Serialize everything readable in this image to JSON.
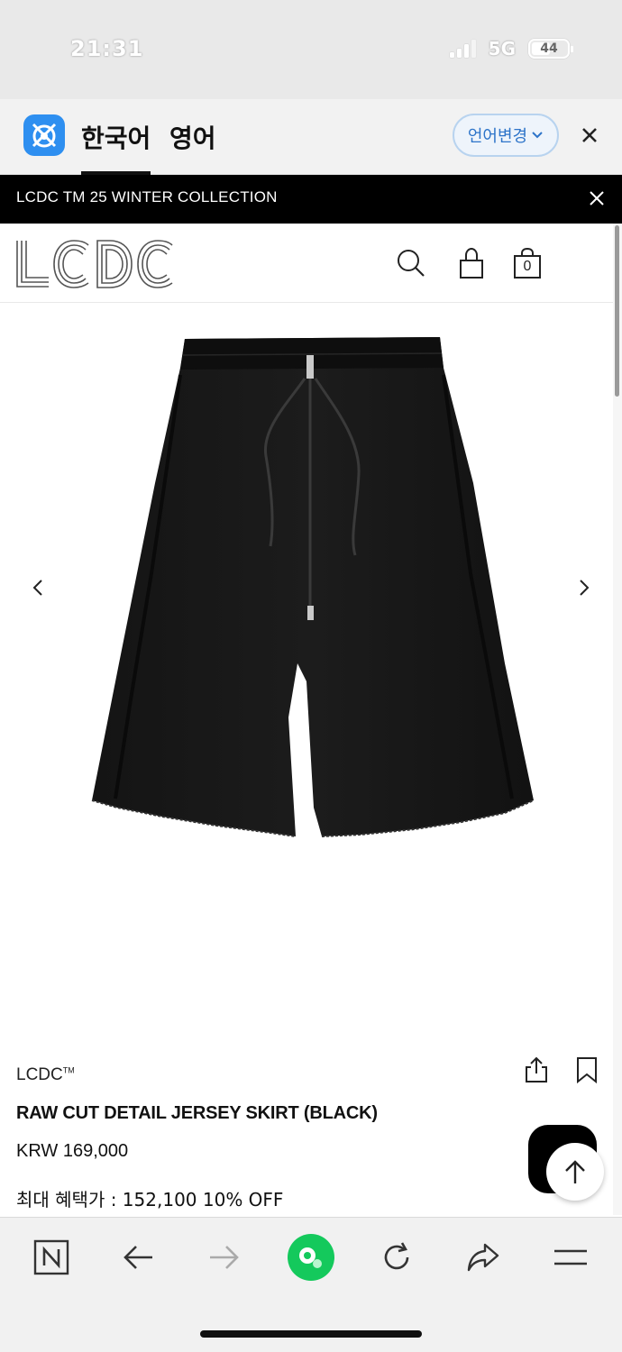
{
  "status_bar": {
    "time": "21:31",
    "network": "5G",
    "battery": "44"
  },
  "translate_bar": {
    "tabs": [
      {
        "label": "한국어",
        "active": true
      },
      {
        "label": "영어",
        "active": false
      }
    ],
    "change_language_label": "언어변경"
  },
  "banner": {
    "text": "LCDC TM 25 WINTER COLLECTION"
  },
  "header": {
    "logo": "LCDC",
    "cart_count": "0"
  },
  "product": {
    "brand": "LCDC",
    "brand_mark": "TM",
    "name": "RAW CUT DETAIL JERSEY SKIRT (BLACK)",
    "price": "KRW 169,000",
    "benefit": "최대 혜택가 : 152,100 10% OFF"
  },
  "colors": {
    "accent_blue": "#2d74c9",
    "papago_blue": "#2e8ff0",
    "toolbar_green": "#14c95c",
    "banner_bg": "#000000"
  },
  "icons": [
    "papago-icon",
    "close-icon",
    "search-icon",
    "account-icon",
    "cart-icon",
    "chevron-left-icon",
    "chevron-right-icon",
    "share-icon",
    "bookmark-icon",
    "arrow-up-icon",
    "naver-icon",
    "back-arrow-icon",
    "forward-arrow-icon",
    "reload-icon",
    "share-arrow-icon",
    "menu-icon"
  ]
}
